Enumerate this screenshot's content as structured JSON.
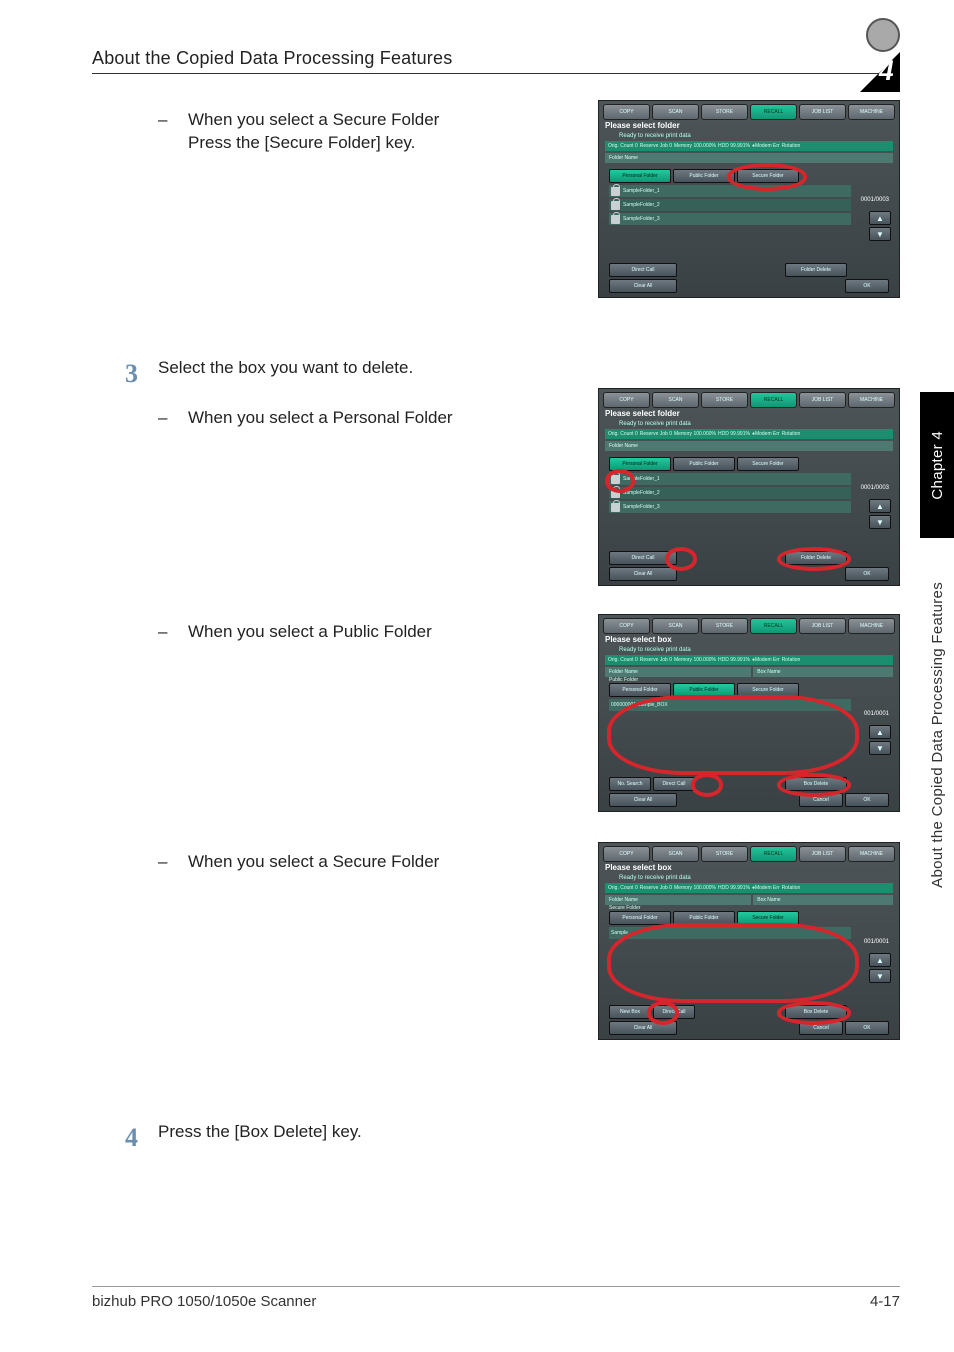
{
  "header": {
    "title": "About the Copied Data Processing Features",
    "chapter_num": "4"
  },
  "sidetab": {
    "chapter": "Chapter 4",
    "section": "About the Copied Data Processing Features"
  },
  "footer": {
    "left": "bizhub PRO 1050/1050e Scanner",
    "right": "4-17"
  },
  "body": {
    "bul1_dash": "–",
    "bul1a": "When you select a Secure Folder",
    "bul1b": "Press the [Secure Folder] key.",
    "step3_num": "3",
    "step3_text": "Select the box you want to delete.",
    "bul2_dash": "–",
    "bul2": "When you select a Personal Folder",
    "bul3_dash": "–",
    "bul3": "When you select a Public Folder",
    "bul4_dash": "–",
    "bul4": "When you select a Secure Folder",
    "step4_num": "4",
    "step4_text": "Press the [Box Delete] key."
  },
  "panel_common": {
    "topbtns": [
      "COPY",
      "SCAN",
      "STORE",
      "RECALL",
      "JOB LIST",
      "MACHINE"
    ],
    "subtitle": "Ready to receive print data",
    "info": [
      "Orig. Count  0",
      "Reserve Job  0",
      "Memory 100.000%",
      "HDD       99.991%",
      "●Modem Err",
      "Rotation"
    ],
    "tabs": [
      "Personal Folder",
      "Public Folder",
      "Secure Folder"
    ],
    "directcall": "Direct Call",
    "folderdel": "Folder Delete",
    "boxdel": "Box Delete",
    "clear": "Clear All",
    "ok": "OK",
    "cancel": "Cancel",
    "foldername": "Folder Name",
    "boxname": "Box Name",
    "nosearch": "No. Search",
    "newbox": "New Box",
    "arrows_up": "▲",
    "arrows_down": "▼"
  },
  "panel1": {
    "title": "Please select folder",
    "rows": [
      "SampleFolder_1",
      "SampleFolder_2",
      "SampleFolder_3"
    ],
    "counter": "0001/0003"
  },
  "panel2": {
    "title": "Please select folder",
    "rows": [
      "SampleFolder_1",
      "SampleFolder_2",
      "SampleFolder_3"
    ],
    "counter": "0001/0003"
  },
  "panel3": {
    "title": "Please select box",
    "subhead": "Public Folder",
    "rows": [
      "000000001 Sample_BOX"
    ],
    "counter": "001/0001"
  },
  "panel4": {
    "title": "Please select box",
    "subhead": "Secure Folder",
    "rows": [
      "Sample"
    ],
    "counter": "001/0001"
  }
}
